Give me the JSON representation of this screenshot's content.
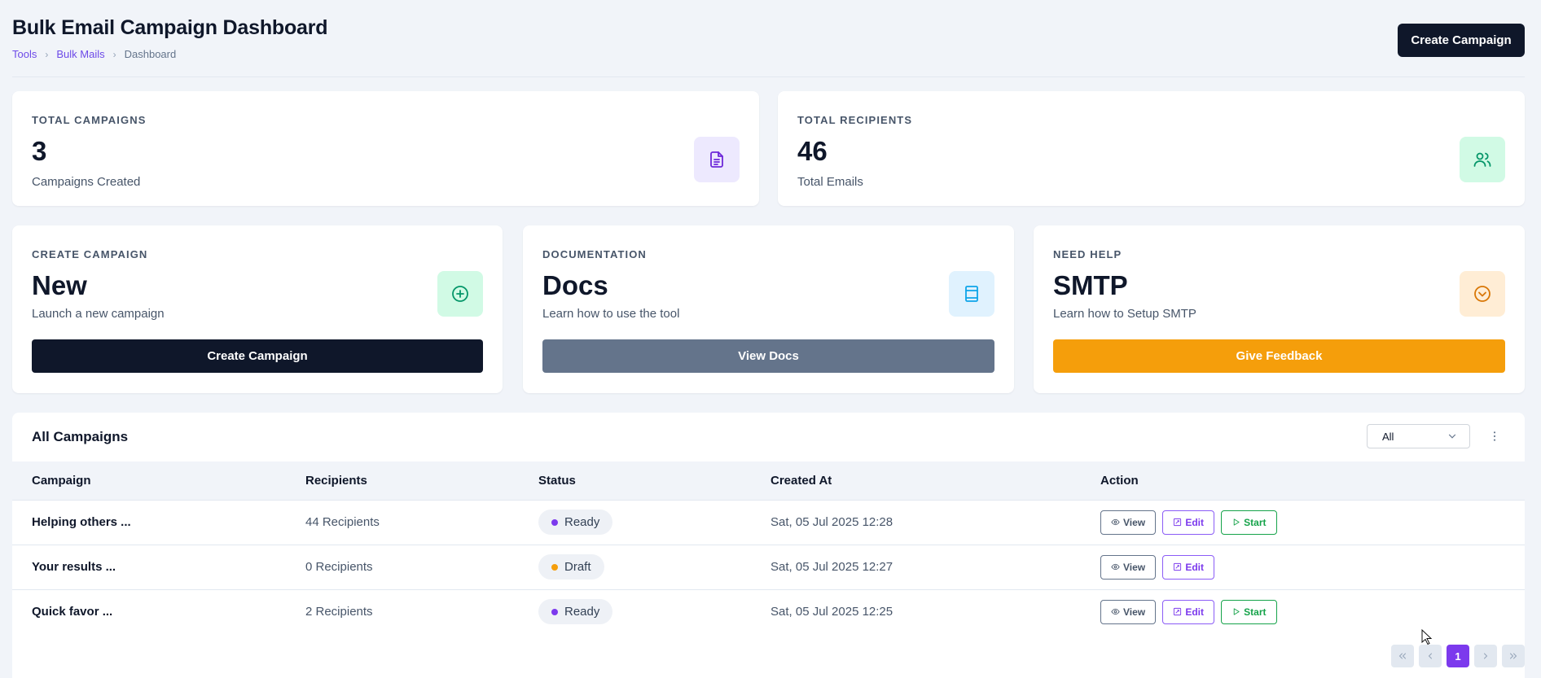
{
  "header": {
    "title": "Bulk Email Campaign Dashboard",
    "breadcrumb": [
      "Tools",
      "Bulk Mails",
      "Dashboard"
    ],
    "create_button": "Create Campaign"
  },
  "stats": [
    {
      "label": "TOTAL CAMPAIGNS",
      "value": "3",
      "sub": "Campaigns Created",
      "icon": "document-icon",
      "icon_bg": "#ede9fe",
      "icon_color": "#6d28d9"
    },
    {
      "label": "TOTAL RECIPIENTS",
      "value": "46",
      "sub": "Total Emails",
      "icon": "users-icon",
      "icon_bg": "#d1fae5",
      "icon_color": "#059669"
    }
  ],
  "actions": [
    {
      "label": "CREATE CAMPAIGN",
      "value": "New",
      "sub": "Launch a new campaign",
      "button": "Create Campaign",
      "button_color": "#0f172a",
      "icon": "plus-circle-icon",
      "icon_bg": "#d1fae5",
      "icon_color": "#059669"
    },
    {
      "label": "DOCUMENTATION",
      "value": "Docs",
      "sub": "Learn how to use the tool",
      "button": "View Docs",
      "button_color": "#64748b",
      "icon": "book-icon",
      "icon_bg": "#e0f2fe",
      "icon_color": "#0ea5e9"
    },
    {
      "label": "NEED HELP",
      "value": "SMTP",
      "sub": "Learn how to Setup SMTP",
      "button": "Give Feedback",
      "button_color": "#f59e0b",
      "icon": "chevron-circle-icon",
      "icon_bg": "#ffedd5",
      "icon_color": "#d97706"
    }
  ],
  "campaigns": {
    "title": "All Campaigns",
    "filter_value": "All",
    "columns": [
      "Campaign",
      "Recipients",
      "Status",
      "Created At",
      "Action"
    ],
    "rows": [
      {
        "name": "Helping others ...",
        "recipients": "44 Recipients",
        "status": "Ready",
        "status_color": "#7c3aed",
        "created": "Sat, 05 Jul 2025 12:28",
        "actions": [
          "View",
          "Edit",
          "Start"
        ]
      },
      {
        "name": "Your results ...",
        "recipients": "0 Recipients",
        "status": "Draft",
        "status_color": "#f59e0b",
        "created": "Sat, 05 Jul 2025 12:27",
        "actions": [
          "View",
          "Edit"
        ]
      },
      {
        "name": "Quick favor ...",
        "recipients": "2 Recipients",
        "status": "Ready",
        "status_color": "#7c3aed",
        "created": "Sat, 05 Jul 2025 12:25",
        "actions": [
          "View",
          "Edit",
          "Start"
        ]
      }
    ]
  },
  "pagination": {
    "current_page": "1"
  }
}
